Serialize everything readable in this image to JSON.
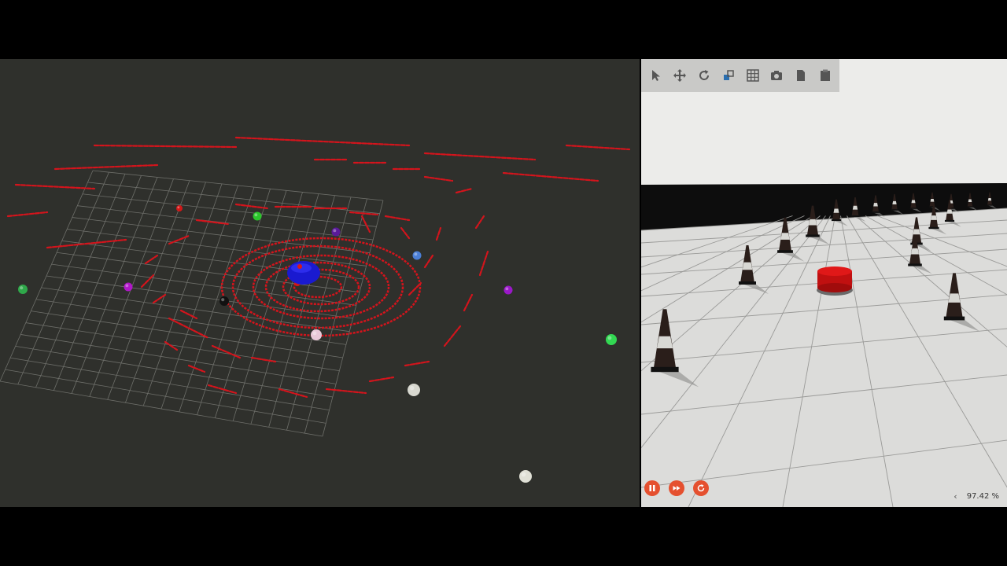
{
  "gazebo": {
    "real_time_factor": "97.42 %",
    "toolbar": [
      {
        "name": "select-tool",
        "icon": "arrow-pointer-icon"
      },
      {
        "name": "translate-tool",
        "icon": "move-arrows-icon"
      },
      {
        "name": "rotate-tool",
        "icon": "rotate-icon"
      },
      {
        "name": "scale-tool",
        "icon": "scale-icon"
      },
      {
        "name": "grid-tool",
        "icon": "grid-icon"
      },
      {
        "name": "screenshot-tool",
        "icon": "camera-icon"
      },
      {
        "name": "copy-tool",
        "icon": "copy-icon"
      },
      {
        "name": "paste-tool",
        "icon": "paste-icon"
      }
    ],
    "controls": [
      {
        "name": "pause",
        "icon": "pause-icon"
      },
      {
        "name": "step",
        "icon": "fast-forward-icon"
      },
      {
        "name": "reset",
        "icon": "reset-icon"
      }
    ]
  },
  "colors": {
    "rviz_bg": "#2f302c",
    "laser": "#d4141c",
    "robot": "#1a1ad0",
    "gazebo_floor": "#dcdcda",
    "control_accent": "#e5502f"
  }
}
